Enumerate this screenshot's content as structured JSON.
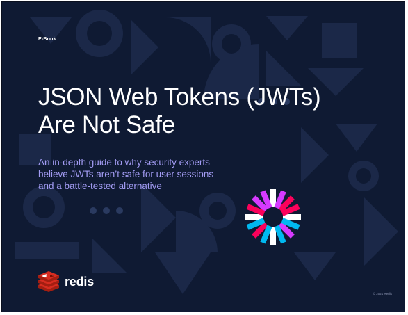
{
  "document": {
    "label": "E-Book",
    "title": "JSON Web Tokens (JWTs) Are Not Safe",
    "subtitle": "An in-depth guide to why security experts believe JWTs aren’t safe for user sessions—and a battle-tested alternative",
    "brand": "redis",
    "copyright": "© 2021 Redis"
  },
  "colors": {
    "background": "#0f1a33",
    "shape": "#1b2848",
    "subtitle": "#a39cf4",
    "redis_red": "#d82c20",
    "jwt_pink": "#fb015b",
    "jwt_magenta": "#d63aff",
    "jwt_cyan": "#00b9f1",
    "jwt_white": "#ffffff"
  },
  "icons": [
    "redis-logo-icon",
    "jwt-logo-icon"
  ]
}
